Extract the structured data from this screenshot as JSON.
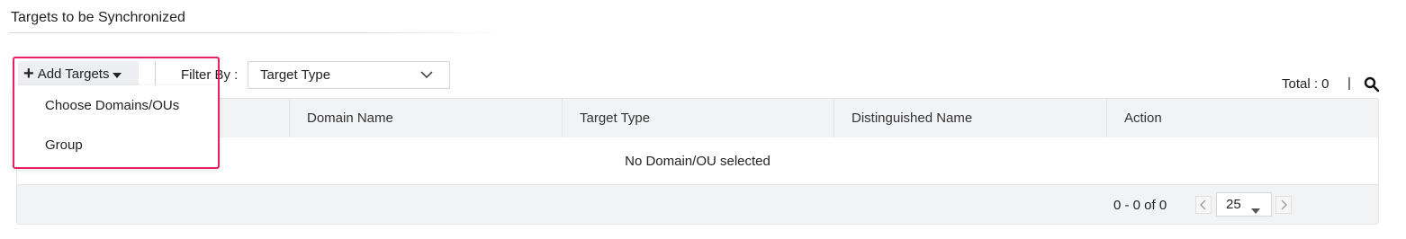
{
  "section": {
    "title": "Targets to be Synchronized"
  },
  "toolbar": {
    "add_targets_label": "Add Targets",
    "filter_label": "Filter By :",
    "filter_value": "Target Type",
    "total_label": "Total : 0",
    "separator": "|"
  },
  "menu": {
    "items": [
      {
        "label": "Choose Domains/OUs"
      },
      {
        "label": "Group"
      }
    ]
  },
  "table": {
    "columns": [
      {
        "label": ""
      },
      {
        "label": "Domain Name"
      },
      {
        "label": "Target Type"
      },
      {
        "label": "Distinguished Name"
      },
      {
        "label": "Action"
      }
    ],
    "empty_message": "No Domain/OU selected"
  },
  "pagination": {
    "range": "0 - 0 of 0",
    "page_size": "25"
  },
  "colors": {
    "highlight": "#e91e63",
    "header_bg": "#f2f3f5",
    "button_bg": "#eceef1"
  },
  "icons": {
    "add": "plus-icon",
    "dropdown": "caret-down-icon",
    "filter_chevron": "chevron-down-icon",
    "search": "search-icon",
    "prev": "chevron-left-icon",
    "next": "chevron-right-icon"
  }
}
